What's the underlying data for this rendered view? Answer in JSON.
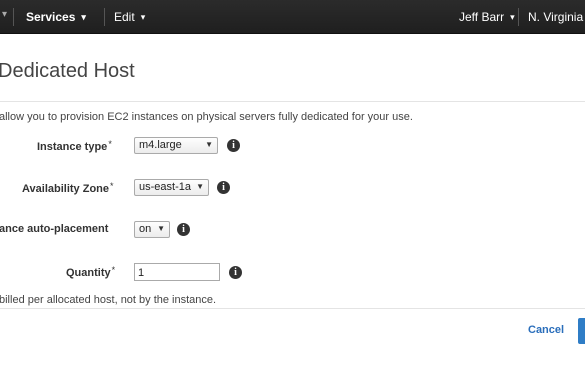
{
  "nav": {
    "services_label": "Services",
    "edit_label": "Edit",
    "user_label": "Jeff Barr",
    "region_label": "N. Virginia"
  },
  "page": {
    "title": "Dedicated Host",
    "description": "allow you to provision EC2 instances on physical servers fully dedicated for your use."
  },
  "form": {
    "instance_type": {
      "label": "Instance type",
      "required_mark": "*",
      "value": "m4.large"
    },
    "availability_zone": {
      "label": "Availability Zone",
      "required_mark": "*",
      "value": "us-east-1a"
    },
    "auto_placement": {
      "label": "ance auto-placement",
      "value": "on"
    },
    "quantity": {
      "label": "Quantity",
      "required_mark": "*",
      "value": "1"
    },
    "info_glyph": "i"
  },
  "footer": {
    "billing_note": "billed per allocated host, not by the instance.",
    "cancel_label": "Cancel"
  },
  "colors": {
    "topbar": "#232f3e",
    "link": "#2a6ebb",
    "primary_button": "#2f7dc6"
  }
}
